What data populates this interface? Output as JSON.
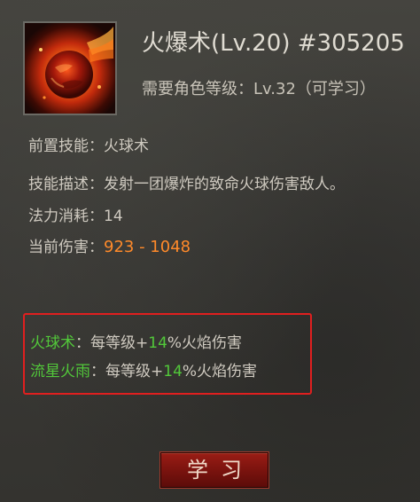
{
  "skill": {
    "title": "火爆术(Lv.20) #305205",
    "requirement": "需要角色等级：Lv.32（可学习）",
    "icon": "fireball-skill-icon"
  },
  "details": {
    "prereq_label": "前置技能：",
    "prereq_value": "火球术",
    "desc_label": "技能描述：",
    "desc_value": "发射一团爆炸的致命火球伤害敌人。",
    "mana_label": "法力消耗：",
    "mana_value": "14",
    "damage_label": "当前伤害：",
    "damage_value": "923 - 1048"
  },
  "bonuses": [
    {
      "skill": "火球术",
      "sep": "：",
      "pre": "每等级+",
      "pct": "14",
      "post": "%火焰伤害"
    },
    {
      "skill": "流星火雨",
      "sep": "：",
      "pre": "每等级+",
      "pct": "14",
      "post": "%火焰伤害"
    }
  ],
  "button": {
    "label": "学习"
  },
  "colors": {
    "damage": "#ff8a2a",
    "bonus_highlight": "#52c83a",
    "highlight_box": "#e01f1f",
    "button": "#8a1a12"
  }
}
